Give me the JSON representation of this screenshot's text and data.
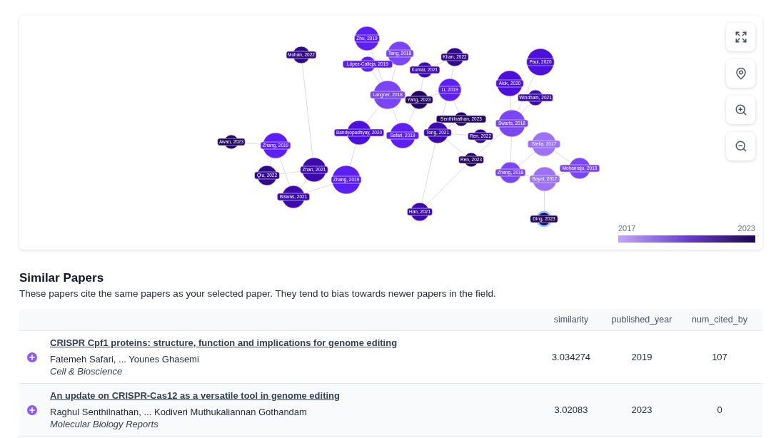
{
  "graph": {
    "nodes": [
      {
        "label": "Zhu, 2019",
        "color": "#5d1ff4",
        "selected": false
      },
      {
        "label": "Tang, 2018",
        "color": "#7b45f5",
        "selected": false
      },
      {
        "label": "López-Calleja, 2019",
        "color": "#5d1ff4",
        "selected": false
      },
      {
        "label": "Mohan, 2022",
        "color": "#31088a",
        "selected": false
      },
      {
        "label": "Khan, 2022",
        "color": "#31088a",
        "selected": false
      },
      {
        "label": "Paul, 2020",
        "color": "#4c0fdc",
        "selected": false
      },
      {
        "label": "Kumar, 2021",
        "color": "#3d0aae",
        "selected": false
      },
      {
        "label": "Alok, 2020",
        "color": "#4c0fdc",
        "selected": false
      },
      {
        "label": "Li, 2019",
        "color": "#5d1ff4",
        "selected": false
      },
      {
        "label": "Langner, 2018",
        "color": "#7b45f5",
        "selected": false
      },
      {
        "label": "Windham, 2021",
        "color": "#3d0aae",
        "selected": false
      },
      {
        "label": "Yang, 2023",
        "color": "#230560",
        "selected": false
      },
      {
        "label": "Senthilnathan, 2023",
        "color": "#230560",
        "selected": false
      },
      {
        "label": "Swarts, 2018",
        "color": "#7b45f5",
        "selected": false
      },
      {
        "label": "Bandyopadhyay, 2020",
        "color": "#4c0fdc",
        "selected": false
      },
      {
        "label": "Safari, 2019",
        "color": "#5d1ff4",
        "selected": false
      },
      {
        "label": "Tong, 2021",
        "color": "#3d0aae",
        "selected": false
      },
      {
        "label": "Ren, 2022",
        "color": "#31088a",
        "selected": false
      },
      {
        "label": "Awan, 2023",
        "color": "#230560",
        "selected": false
      },
      {
        "label": "Zhang, 2019",
        "color": "#5d1ff4",
        "selected": false
      },
      {
        "label": "Stella, 2017",
        "color": "#9e72f7",
        "selected": false
      },
      {
        "label": "Ren, 2023",
        "color": "#230560",
        "selected": false
      },
      {
        "label": "Zhan, 2021",
        "color": "#3d0aae",
        "selected": false
      },
      {
        "label": "Zhang, 2018",
        "color": "#7b45f5",
        "selected": false
      },
      {
        "label": "Mohanraju, 2018",
        "color": "#7b45f5",
        "selected": false
      },
      {
        "label": "Qiu, 2022",
        "color": "#31088a",
        "selected": false
      },
      {
        "label": "Bayat, 2017",
        "color": "#9e72f7",
        "selected": false
      },
      {
        "label": "Zhang, 2019",
        "color": "#5d1ff4",
        "selected": false
      },
      {
        "label": "Biswas, 2021",
        "color": "#3d0aae",
        "selected": false
      },
      {
        "label": "Han, 2021",
        "color": "#3d0aae",
        "selected": false
      },
      {
        "label": "Ding, 2023",
        "color": "#230560",
        "selected": true
      }
    ],
    "controls": [
      {
        "kind": "fit"
      },
      {
        "kind": "locate"
      },
      {
        "kind": "zoom_in"
      },
      {
        "kind": "zoom_out"
      }
    ],
    "legend": {
      "min_label": "2017",
      "max_label": "2023"
    }
  },
  "similar_papers": {
    "title": "Similar Papers",
    "description": "These papers cite the same papers as your selected paper. They tend to bias towards newer papers in the field.",
    "columns": [
      "similarity",
      "published_year",
      "num_cited_by"
    ],
    "rows": [
      {
        "title": "CRISPR Cpf1 proteins: structure, function and implications for genome editing",
        "authors": "Fatemeh Safari, ... Younes Ghasemi",
        "journal": "Cell & Bioscience",
        "similarity": "3.034274",
        "published_year": "2019",
        "num_cited_by": "107"
      },
      {
        "title": "An update on CRISPR-Cas12 as a versatile tool in genome editing",
        "authors": "Raghul Senthilnathan, ... Kodiveri Muthukaliannan Gothandam",
        "journal": "Molecular Biology Reports",
        "similarity": "3.02083",
        "published_year": "2023",
        "num_cited_by": "0"
      }
    ]
  }
}
